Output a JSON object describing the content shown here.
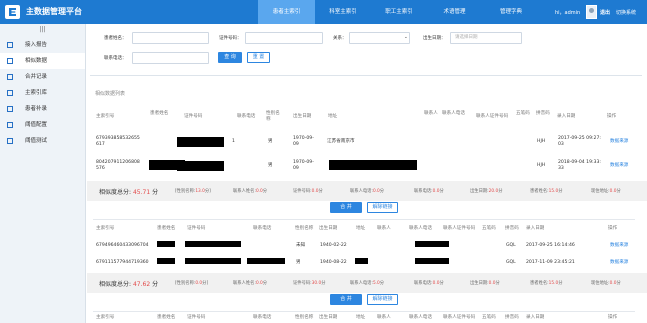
{
  "app": {
    "title": "主数据管理平台",
    "user_name": "hi，admin",
    "logout": "退出",
    "switch_system": "切换系统"
  },
  "nav": {
    "items": [
      "患者主索引",
      "科室主索引",
      "职工主索引",
      "术语管理",
      "管理字典"
    ]
  },
  "sidebar": {
    "collapse": "|||",
    "items": [
      "接入报告",
      "相似数据",
      "合并记录",
      "主索引库",
      "患者补录",
      "阈值配置",
      "阈值测试"
    ]
  },
  "filters": {
    "patient_name": "患者姓名：",
    "id_number": "证件号码：",
    "relation": "关系：",
    "birth_date": "出生日期：",
    "date_placeholder": "请选择日期",
    "relation_placeholder": "",
    "contact_phone": "联系电话：",
    "search": "查 询",
    "reset": "重 置"
  },
  "section_title": "相似数据列表",
  "table": {
    "headers": [
      "主索引号",
      "患者姓名",
      "证件号码",
      "联系电话",
      "性别名称",
      "出生日期",
      "地址",
      "联系人",
      "联系人电话",
      "联系人证件号码",
      "五笔码",
      "拼音码",
      "录入日期",
      "操作"
    ],
    "groups": [
      {
        "rows": [
          {
            "id": "679393858532655\n617",
            "phone": "1",
            "gender": "男",
            "birth": "1970-09-\n09",
            "address": "江苏省南京市",
            "pinyin": "HJH",
            "date": "2017-09-25 09:27:\n03",
            "action": "数据来源"
          },
          {
            "id": "804207911206808\n576",
            "phone": "",
            "gender": "男",
            "birth": "1970-09-\n09",
            "address": "",
            "pinyin": "HJH",
            "date": "2018-09-04 19:33:\n33",
            "action": "数据来源"
          }
        ],
        "summary": {
          "score_label": "相似度总分:",
          "score": "45.71",
          "score_unit": "分",
          "items": [
            {
              "label": "[性别名称:",
              "value": "13.0",
              "unit": "分]"
            },
            {
              "label": "联系人姓名:",
              "value": "0.0",
              "unit": "分"
            },
            {
              "label": "证件号码:",
              "value": "0.0",
              "unit": "分"
            },
            {
              "label": "联系人电话:",
              "value": "0.0",
              "unit": "分"
            },
            {
              "label": "联系电话:",
              "value": "0.0",
              "unit": "分"
            },
            {
              "label": "出生日期:",
              "value": "20.0",
              "unit": "分"
            },
            {
              "label": "患者姓名:",
              "value": "15.0",
              "unit": "分"
            },
            {
              "label": "现住地址:",
              "value": "0.0",
              "unit": "分"
            }
          ]
        },
        "merge": "合 并",
        "unlink": "解除链接"
      },
      {
        "rows": [
          {
            "id": "679496460433096704",
            "phone": "",
            "gender": "未知",
            "birth": "1940-02-22",
            "address": "",
            "pinyin": "GQL",
            "date": "2017-09-25 16:14:46",
            "action": "数据来源"
          },
          {
            "id": "679111577944719360",
            "phone": "",
            "gender": "男",
            "birth": "1940-08-22",
            "address": "",
            "pinyin": "GQL",
            "date": "2017-11-09 23:45:21",
            "action": "数据来源"
          }
        ],
        "summary": {
          "score_label": "相似度总分:",
          "score": "47.62",
          "score_unit": "分",
          "items": [
            {
              "label": "[性别名称:",
              "value": "0.0",
              "unit": "分]"
            },
            {
              "label": "联系人姓名:",
              "value": "0.0",
              "unit": "分"
            },
            {
              "label": "证件号码:",
              "value": "30.0",
              "unit": "分"
            },
            {
              "label": "联系人电话:",
              "value": "5.0",
              "unit": "分"
            },
            {
              "label": "联系电话:",
              "value": "0.0",
              "unit": "分"
            },
            {
              "label": "出生日期:",
              "value": "0.0",
              "unit": "分"
            },
            {
              "label": "患者姓名:",
              "value": "15.0",
              "unit": "分"
            },
            {
              "label": "现住地址:",
              "value": "0.0",
              "unit": "分"
            }
          ]
        },
        "merge": "合 并",
        "unlink": "解除链接"
      }
    ],
    "bottom_headers": [
      "主索引号",
      "患者姓名",
      "证件号码",
      "联系电话",
      "性别名称",
      "出生日期",
      "地址",
      "联系人",
      "联系人电话",
      "联系人证件号码",
      "五笔码",
      "拼音码",
      "录入日期",
      "操作"
    ]
  }
}
